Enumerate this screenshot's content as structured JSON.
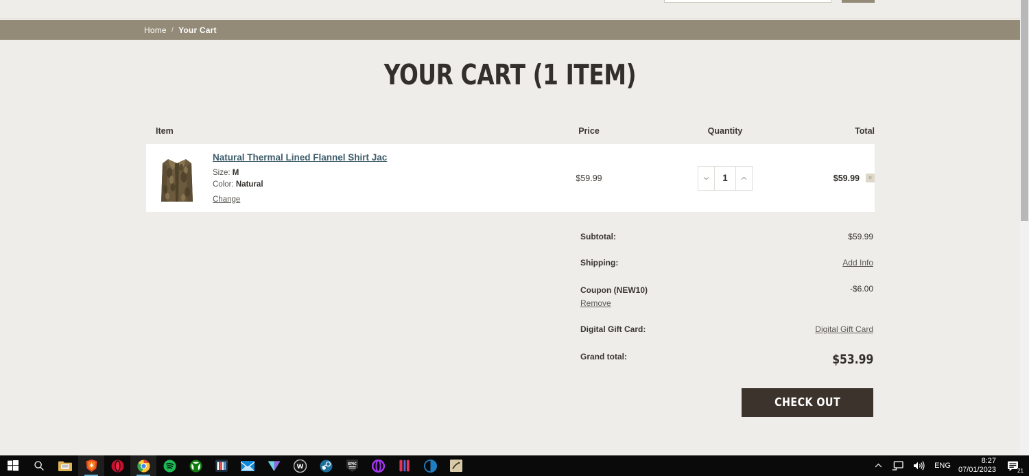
{
  "header": {
    "search_placeholder": "",
    "search_button_label": ""
  },
  "breadcrumb": {
    "home_label": "Home",
    "separator": "/",
    "current_label": "Your Cart"
  },
  "page": {
    "title": "YOUR CART (1 ITEM)"
  },
  "cart": {
    "columns": {
      "item": "Item",
      "price": "Price",
      "quantity": "Quantity",
      "total": "Total"
    },
    "items": [
      {
        "name": "Natural Thermal Lined Flannel Shirt Jac",
        "size_label": "Size:",
        "size_value": "M",
        "color_label": "Color:",
        "color_value": "Natural",
        "change_label": "Change",
        "price": "$59.99",
        "quantity": "1",
        "decrement_icon": "chevron-down-icon",
        "increment_icon": "chevron-up-icon",
        "total": "$59.99",
        "remove_icon": "close-icon",
        "remove_label": "×"
      }
    ]
  },
  "summary": {
    "subtotal_label": "Subtotal:",
    "subtotal_value": "$59.99",
    "shipping_label": "Shipping:",
    "shipping_link": "Add Info",
    "coupon_label": "Coupon (NEW10)",
    "coupon_value": "-$6.00",
    "coupon_remove_link": "Remove",
    "gift_card_label": "Digital Gift Card:",
    "gift_card_link": "Digital Gift Card",
    "grand_total_label": "Grand total:",
    "grand_total_value": "$53.99",
    "checkout_label": "CHECK OUT"
  },
  "colors": {
    "breadcrumb_bar": "#938a77",
    "page_background": "#eeedea",
    "checkout_button": "#3c342c",
    "link": "#3f5d6b",
    "remove_button": "#ded7c7"
  },
  "taskbar": {
    "items": [
      {
        "name": "start-button",
        "icon": "windows-icon"
      },
      {
        "name": "search-button",
        "icon": "search-icon"
      },
      {
        "name": "file-explorer",
        "icon": "folder-icon"
      },
      {
        "name": "brave-browser",
        "icon": "brave-icon"
      },
      {
        "name": "opera-browser",
        "icon": "opera-icon"
      },
      {
        "name": "google-chrome",
        "icon": "chrome-icon"
      },
      {
        "name": "spotify",
        "icon": "spotify-icon"
      },
      {
        "name": "xbox-app",
        "icon": "xbox-icon"
      },
      {
        "name": "app-colored-bars",
        "icon": "bars-icon"
      },
      {
        "name": "mail-app",
        "icon": "mail-icon"
      },
      {
        "name": "vercel-app",
        "icon": "triangle-icon"
      },
      {
        "name": "wiki-app",
        "icon": "w-badge-icon"
      },
      {
        "name": "steam",
        "icon": "steam-icon"
      },
      {
        "name": "epic-games",
        "icon": "epic-icon"
      },
      {
        "name": "app-purple-ring",
        "icon": "ring-icon"
      },
      {
        "name": "app-red-bars",
        "icon": "red-bars-icon"
      },
      {
        "name": "app-half-circle",
        "icon": "half-circle-icon"
      },
      {
        "name": "app-tan-tile",
        "icon": "tan-tile-icon"
      }
    ],
    "tray": {
      "show_hidden_icon": "chevron-up-icon",
      "network_icon": "network-icon",
      "volume_icon": "volume-icon",
      "language": "ENG",
      "time": "8:27",
      "date": "07/01/2023",
      "notifications_icon": "notifications-icon",
      "notifications_count": "21"
    }
  }
}
